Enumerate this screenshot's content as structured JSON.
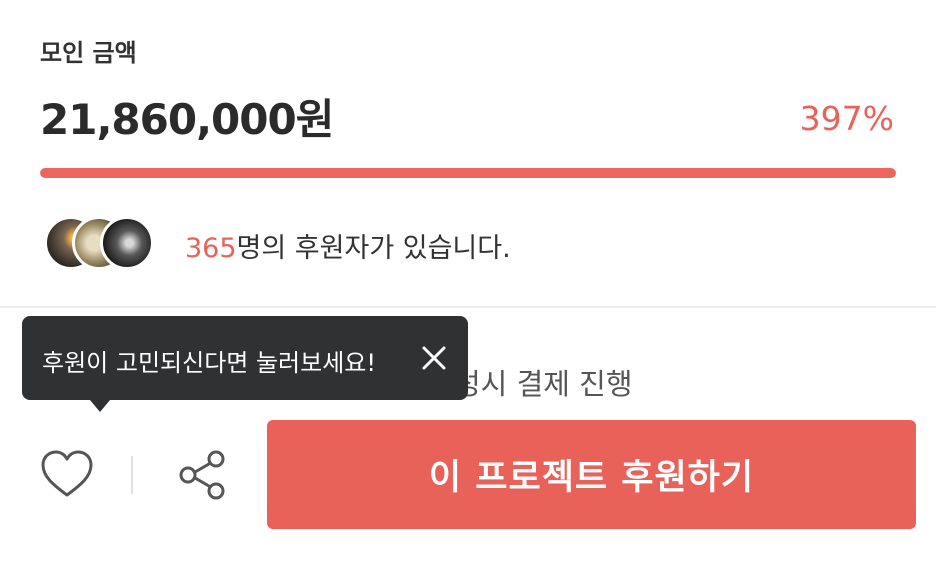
{
  "funding": {
    "label": "모인 금액",
    "amount": "21,860,000원",
    "percent_text": "397%",
    "progress": 1.0,
    "accent_color": "#e8625a"
  },
  "backers": {
    "count": "365",
    "text": "명의 후원자가 있습니다.",
    "avatars": [
      "avatar",
      "avatar",
      "avatar"
    ]
  },
  "notice": {
    "text": "성시 결제 진행"
  },
  "tooltip": {
    "text": "후원이 고민되신다면 눌러보세요!",
    "close_icon": "close-icon"
  },
  "actions": {
    "like_icon": "heart-icon",
    "share_icon": "share-icon",
    "support_label": "이 프로젝트 후원하기",
    "support_color": "#e9625a"
  }
}
